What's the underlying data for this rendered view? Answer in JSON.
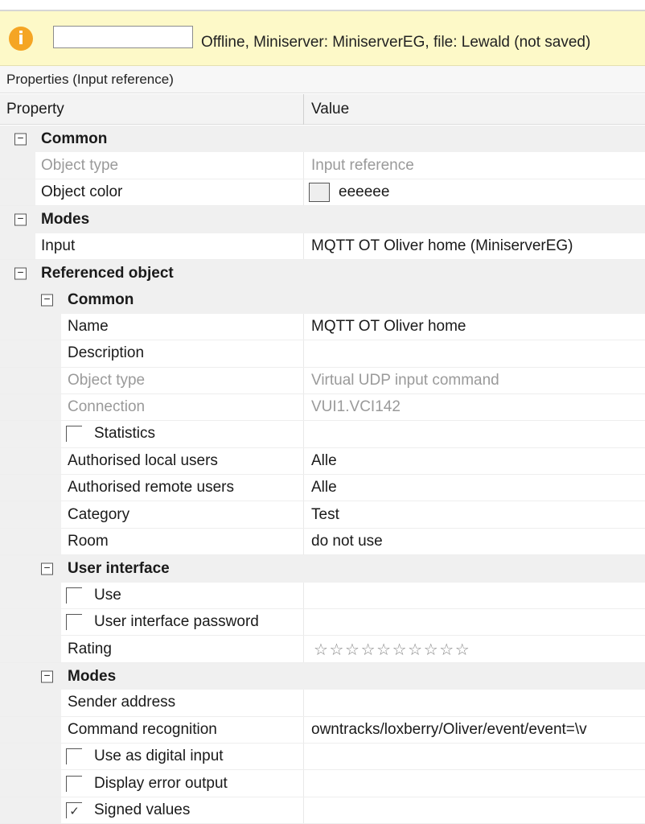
{
  "status": {
    "text": "Offline, Miniserver: MiniserverEG, file: Lewald (not saved)",
    "input_value": "",
    "icon": "info-icon"
  },
  "panel": {
    "title": "Properties (Input reference)"
  },
  "columns": {
    "property": "Property",
    "value": "Value"
  },
  "colors": {
    "object_color": "#eeeeee",
    "status_background": "#fdf9c8",
    "info_icon": "#f5a524"
  },
  "rows": [
    {
      "type": "cat",
      "level": 0,
      "label": "Common"
    },
    {
      "type": "item",
      "level": 0,
      "label": "Object type",
      "value": "Input reference",
      "muted": true
    },
    {
      "type": "color",
      "level": 0,
      "label": "Object color",
      "value": "eeeeee"
    },
    {
      "type": "cat",
      "level": 0,
      "label": "Modes"
    },
    {
      "type": "item",
      "level": 0,
      "label": "Input",
      "value": "MQTT OT Oliver home (MiniserverEG)"
    },
    {
      "type": "cat",
      "level": 0,
      "label": "Referenced object"
    },
    {
      "type": "cat",
      "level": 1,
      "label": "Common"
    },
    {
      "type": "item",
      "level": 1,
      "label": "Name",
      "value": "MQTT OT Oliver home"
    },
    {
      "type": "item",
      "level": 1,
      "label": "Description",
      "value": ""
    },
    {
      "type": "item",
      "level": 1,
      "label": "Object type",
      "value": "Virtual UDP input command",
      "muted": true
    },
    {
      "type": "item",
      "level": 1,
      "label": "Connection",
      "value": "VUI1.VCI142",
      "muted": true
    },
    {
      "type": "check",
      "level": 1,
      "label": "Statistics",
      "checked": false
    },
    {
      "type": "item",
      "level": 1,
      "label": "Authorised local users",
      "value": "Alle"
    },
    {
      "type": "item",
      "level": 1,
      "label": "Authorised remote users",
      "value": "Alle"
    },
    {
      "type": "item",
      "level": 1,
      "label": "Category",
      "value": "Test"
    },
    {
      "type": "item",
      "level": 1,
      "label": "Room",
      "value": "do not use"
    },
    {
      "type": "cat",
      "level": 1,
      "label": "User interface"
    },
    {
      "type": "check",
      "level": 1,
      "label": "Use",
      "checked": false
    },
    {
      "type": "check",
      "level": 1,
      "label": "User interface password",
      "checked": false
    },
    {
      "type": "stars",
      "level": 1,
      "label": "Rating",
      "value": "☆☆☆☆☆☆☆☆☆☆",
      "rating": 0
    },
    {
      "type": "cat",
      "level": 1,
      "label": "Modes"
    },
    {
      "type": "item",
      "level": 1,
      "label": "Sender address",
      "value": ""
    },
    {
      "type": "item",
      "level": 1,
      "label": "Command recognition",
      "value": "owntracks/loxberry/Oliver/event/event=\\v"
    },
    {
      "type": "check",
      "level": 1,
      "label": "Use as digital input",
      "checked": false
    },
    {
      "type": "check",
      "level": 1,
      "label": "Display error output",
      "checked": false
    },
    {
      "type": "check",
      "level": 1,
      "label": "Signed values",
      "checked": true
    }
  ]
}
